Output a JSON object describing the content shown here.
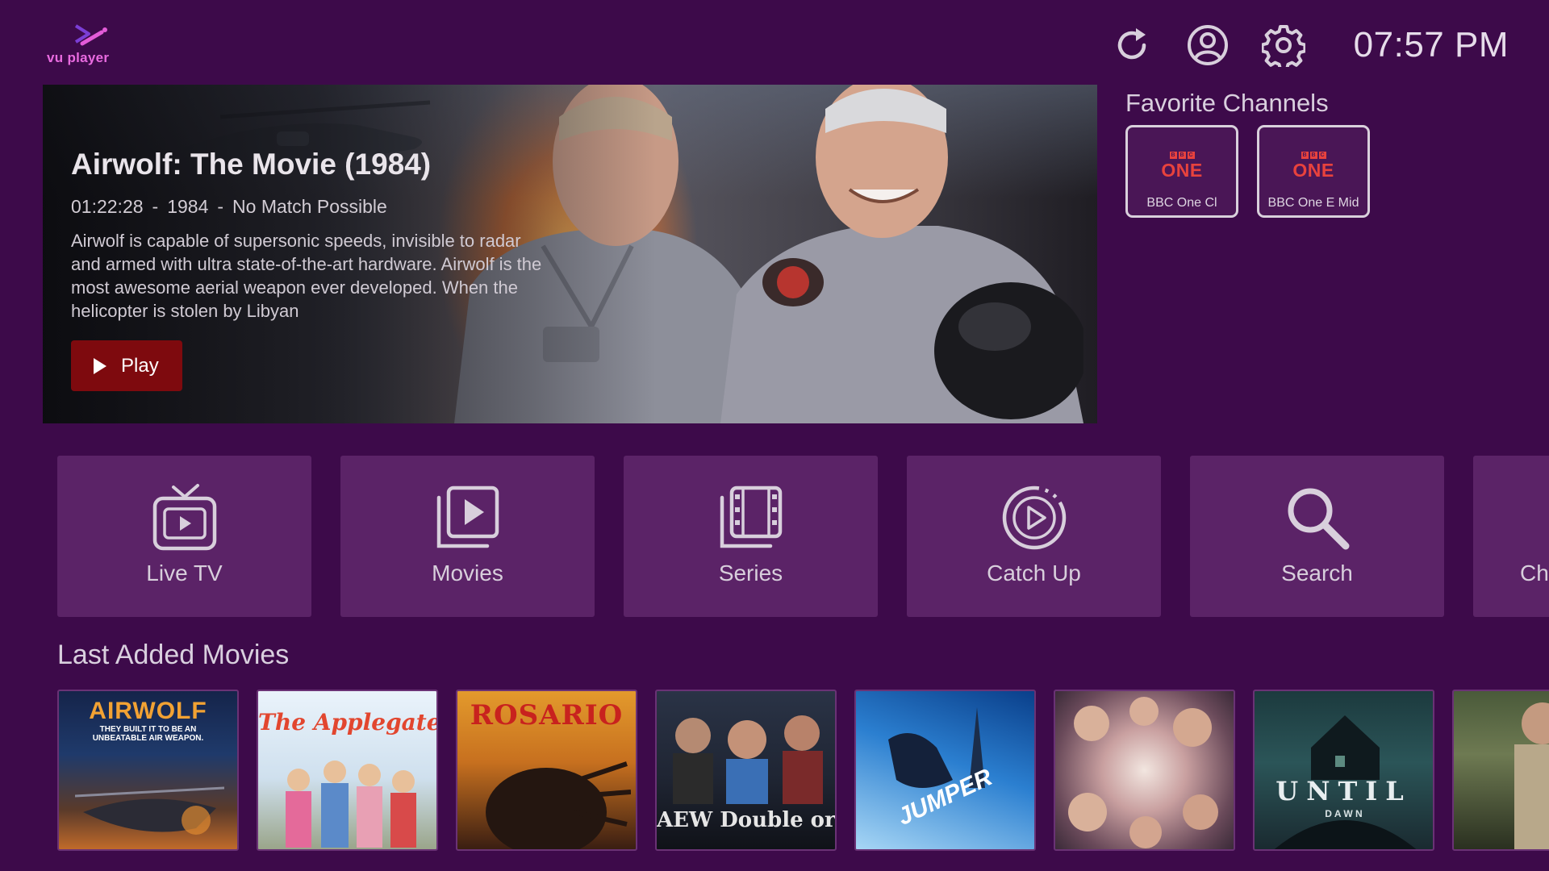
{
  "app": {
    "logo_text": "vu player"
  },
  "header": {
    "time": "07:57 PM",
    "icons": [
      "refresh-icon",
      "profile-icon",
      "settings-icon"
    ]
  },
  "hero": {
    "title": "Airwolf: The Movie (1984)",
    "duration": "01:22:28",
    "year": "1984",
    "rating": "No Match Possible",
    "separator": "-",
    "description": "Airwolf is capable of supersonic speeds, invisible to radar and armed with ultra state-of-the-art hardware. Airwolf is the most awesome aerial weapon ever developed. When the helicopter is stolen by Libyan",
    "play_label": "Play"
  },
  "favorites": {
    "title": "Favorite Channels",
    "channels": [
      {
        "logo_top": "BBC",
        "logo": "ONE",
        "name": "BBC One Cl"
      },
      {
        "logo_top": "BBC",
        "logo": "ONE",
        "name": "BBC One E Mid"
      }
    ]
  },
  "nav": {
    "tiles": [
      {
        "label": "Live TV",
        "icon": "tv-icon"
      },
      {
        "label": "Movies",
        "icon": "movies-icon"
      },
      {
        "label": "Series",
        "icon": "series-icon"
      },
      {
        "label": "Catch Up",
        "icon": "catch-up-icon"
      },
      {
        "label": "Search",
        "icon": "search-icon"
      },
      {
        "label": "Ch",
        "icon": ""
      }
    ]
  },
  "last_added": {
    "title": "Last Added Movies",
    "posters": [
      {
        "title": "AIRWOLF",
        "subtitle": "THEY BUILT IT TO BE AN UNBEATABLE AIR WEAPON."
      },
      {
        "title": "The Applegates"
      },
      {
        "title": "ROSARIO"
      },
      {
        "title": "AEW Double or Nothing"
      },
      {
        "title": "JUMPER"
      },
      {
        "title": ""
      },
      {
        "title": "UNTIL",
        "subtitle": "D A W N"
      },
      {
        "title": ""
      }
    ]
  },
  "colors": {
    "background": "#3d0a4a",
    "tile": "#5b2367",
    "play_button": "#7e0a0e",
    "bbc_red": "#e8423d"
  }
}
